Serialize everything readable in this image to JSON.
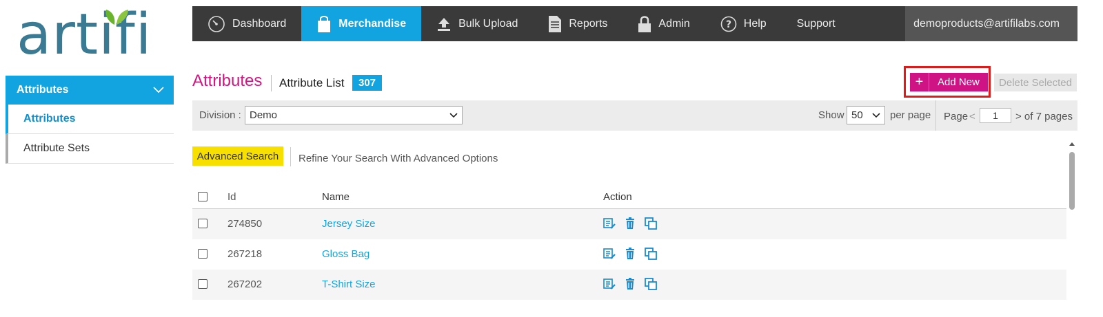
{
  "logo": {
    "text": "artifi"
  },
  "sidebar": {
    "header": "Attributes",
    "items": [
      {
        "label": "Attributes",
        "active": true
      },
      {
        "label": "Attribute Sets",
        "active": false
      }
    ]
  },
  "nav": {
    "items": [
      {
        "label": "Dashboard",
        "icon": "dashboard-gauge-icon"
      },
      {
        "label": "Merchandise",
        "icon": "shopping-bag-icon",
        "active": true
      },
      {
        "label": "Bulk Upload",
        "icon": "upload-icon"
      },
      {
        "label": "Reports",
        "icon": "document-icon"
      },
      {
        "label": "Admin",
        "icon": "lock-icon"
      },
      {
        "label": "Help",
        "icon": "question-icon"
      },
      {
        "label": "Support"
      }
    ],
    "user_email": "demoproducts@artifilabs.com"
  },
  "page": {
    "title": "Attributes",
    "subtitle": "Attribute List",
    "count": "307"
  },
  "actions": {
    "add_new": "Add New",
    "add_plus": "+",
    "delete_selected": "Delete Selected"
  },
  "filter": {
    "division_label": "Division :",
    "division_value": "Demo",
    "show_label": "Show",
    "show_value": "50",
    "per_page_label": "per page",
    "page_label": "Page",
    "page_prev": "<",
    "page_value": "1",
    "page_of": "> of 7 pages"
  },
  "advanced": {
    "button": "Advanced Search",
    "hint": "Refine Your Search With Advanced Options"
  },
  "table": {
    "headers": {
      "id": "Id",
      "name": "Name",
      "action": "Action"
    },
    "rows": [
      {
        "id": "274850",
        "name": "Jersey Size"
      },
      {
        "id": "267218",
        "name": "Gloss Bag"
      },
      {
        "id": "267202",
        "name": "T-Shirt Size"
      }
    ]
  },
  "colors": {
    "accent_blue": "#12a4e0",
    "magenta": "#cf1385",
    "nav_bg": "#3a3a3a",
    "highlight_red": "#e01919",
    "advanced_yellow": "#f7e000"
  }
}
